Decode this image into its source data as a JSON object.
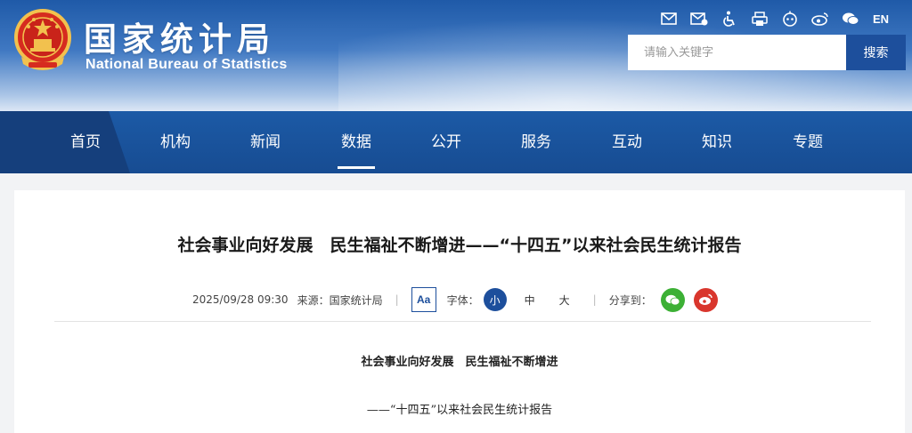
{
  "site": {
    "name_cn": "国家统计局",
    "name_en": "National Bureau of Statistics"
  },
  "toolbar": {
    "icons": [
      "mail-icon",
      "mail-check-icon",
      "accessibility-icon",
      "printer-icon",
      "robot-icon",
      "weibo-icon",
      "wechat-icon"
    ],
    "lang_label": "EN"
  },
  "search": {
    "placeholder": "请输入关键字",
    "value": "",
    "button_label": "搜索"
  },
  "nav": {
    "items": [
      "首页",
      "机构",
      "新闻",
      "数据",
      "公开",
      "服务",
      "互动",
      "知识",
      "专题"
    ],
    "active": "数据"
  },
  "article": {
    "title": "社会事业向好发展　民生福祉不断增进——“十四五”以来社会民生统计报告",
    "date": "2025/09/28 09:30",
    "source": "来源：国家统计局",
    "font_toggle_label": "Aa",
    "font_label": "字体：",
    "font_sizes": [
      "小",
      "中",
      "大"
    ],
    "font_size_selected": "小",
    "share_label": "分享到：",
    "body_title": "社会事业向好发展　民生福祉不断增进",
    "body_subtitle": "——“十四五”以来社会民生统计报告"
  },
  "colors": {
    "brand_blue": "#1d4f9c",
    "nav_blue": "#1c5aa6",
    "wechat_green": "#3cb035",
    "weibo_red": "#d9362d"
  }
}
